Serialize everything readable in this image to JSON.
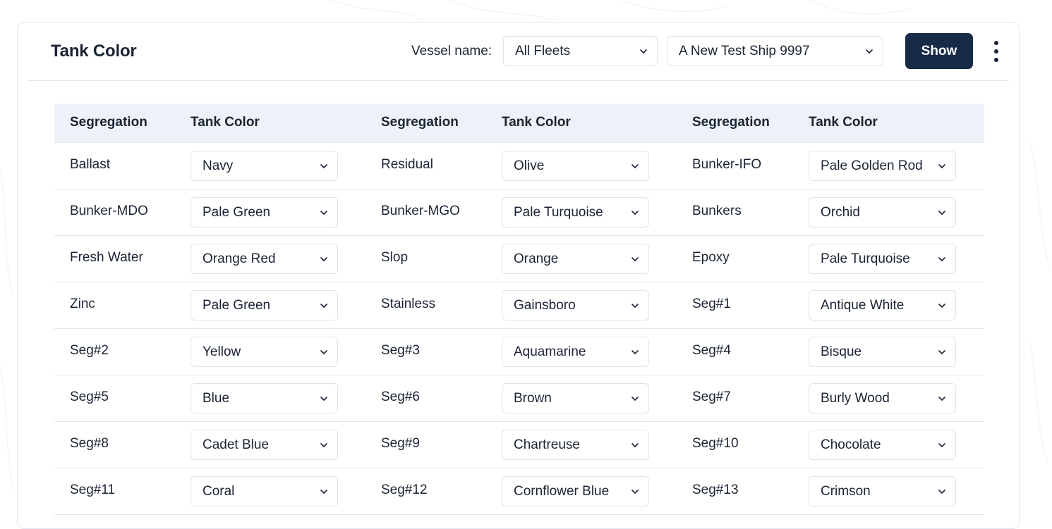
{
  "header": {
    "title": "Tank Color",
    "vessel_label": "Vessel name:",
    "fleet_select": "All Fleets",
    "ship_select": "A New Test Ship 9997",
    "show_button": "Show"
  },
  "table": {
    "headers": [
      "Segregation",
      "Tank Color",
      "Segregation",
      "Tank Color",
      "Segregation",
      "Tank Color"
    ],
    "rows": [
      [
        {
          "seg": "Ballast",
          "color": "Navy"
        },
        {
          "seg": "Residual",
          "color": "Olive"
        },
        {
          "seg": "Bunker-IFO",
          "color": "Pale Golden Rod"
        }
      ],
      [
        {
          "seg": "Bunker-MDO",
          "color": "Pale Green"
        },
        {
          "seg": "Bunker-MGO",
          "color": "Pale Turquoise"
        },
        {
          "seg": "Bunkers",
          "color": "Orchid"
        }
      ],
      [
        {
          "seg": "Fresh Water",
          "color": "Orange Red"
        },
        {
          "seg": "Slop",
          "color": "Orange"
        },
        {
          "seg": "Epoxy",
          "color": "Pale Turquoise"
        }
      ],
      [
        {
          "seg": "Zinc",
          "color": "Pale Green"
        },
        {
          "seg": "Stainless",
          "color": "Gainsboro"
        },
        {
          "seg": "Seg#1",
          "color": "Antique White"
        }
      ],
      [
        {
          "seg": "Seg#2",
          "color": "Yellow"
        },
        {
          "seg": "Seg#3",
          "color": "Aquamarine"
        },
        {
          "seg": "Seg#4",
          "color": "Bisque"
        }
      ],
      [
        {
          "seg": "Seg#5",
          "color": "Blue"
        },
        {
          "seg": "Seg#6",
          "color": "Brown"
        },
        {
          "seg": "Seg#7",
          "color": "Burly Wood"
        }
      ],
      [
        {
          "seg": "Seg#8",
          "color": "Cadet Blue"
        },
        {
          "seg": "Seg#9",
          "color": "Chartreuse"
        },
        {
          "seg": "Seg#10",
          "color": "Chocolate"
        }
      ],
      [
        {
          "seg": "Seg#11",
          "color": "Coral"
        },
        {
          "seg": "Seg#12",
          "color": "Cornflower Blue"
        },
        {
          "seg": "Seg#13",
          "color": "Crimson"
        }
      ]
    ]
  },
  "icons": {
    "dropdown": "chevron-down-icon",
    "more": "more-vertical-icon"
  },
  "colors": {
    "primary_button": "#172a46",
    "table_header_bg": "#eef2f8",
    "border": "#e3e7ee",
    "text": "#1b2433"
  }
}
